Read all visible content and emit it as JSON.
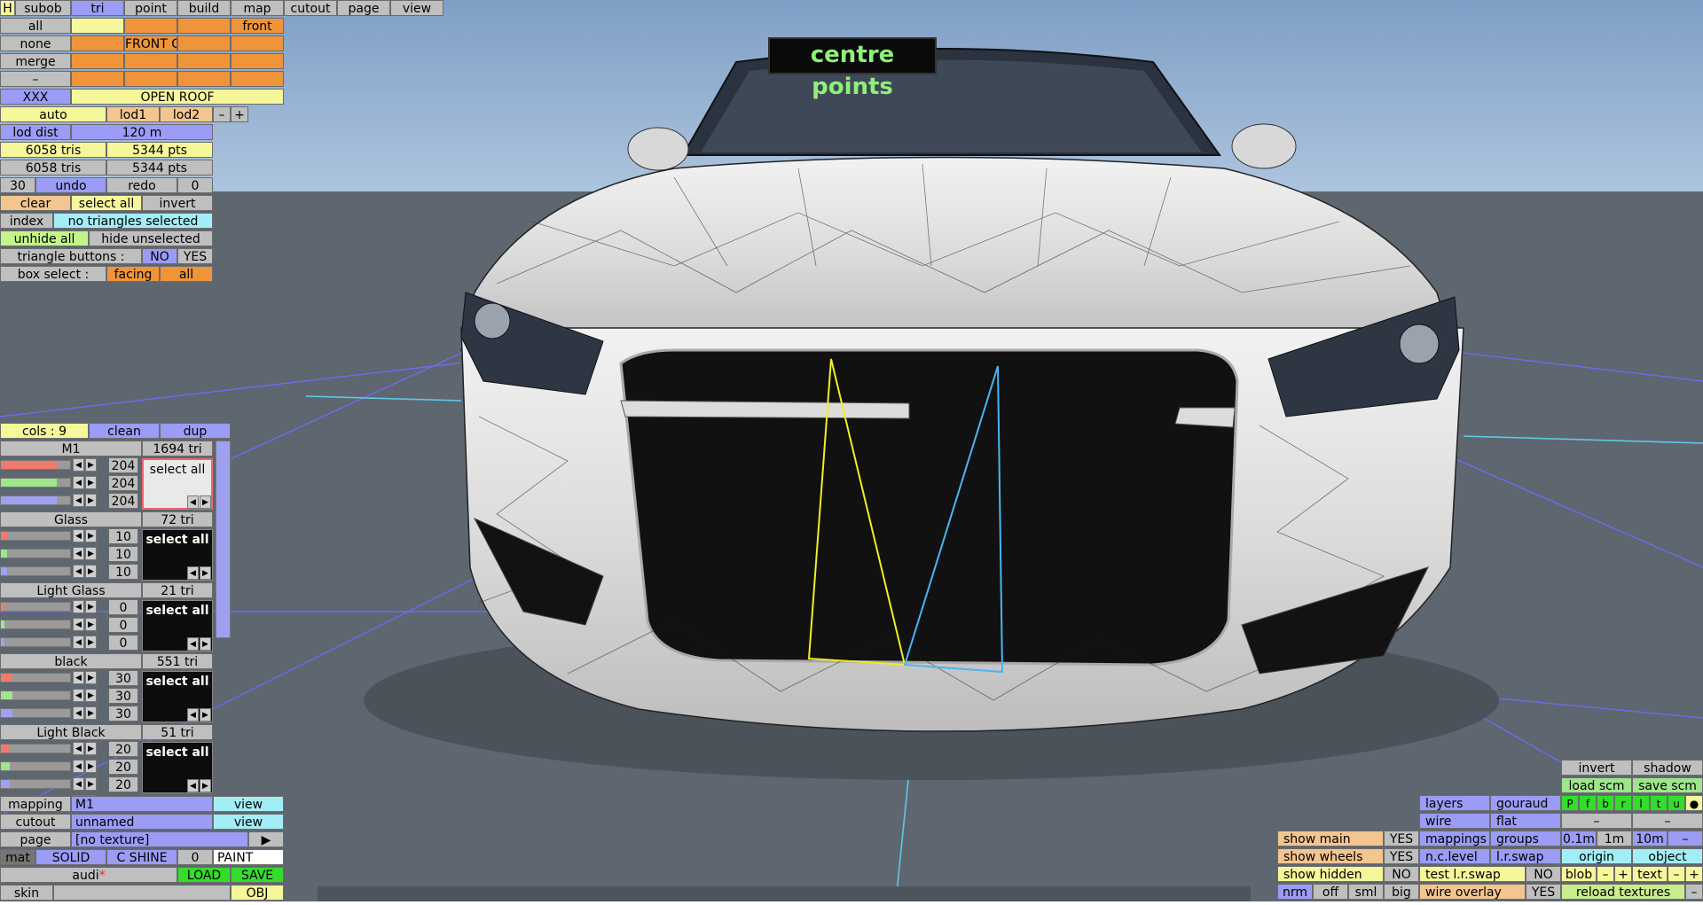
{
  "app": {
    "overlay_title": "centre points"
  },
  "menu": [
    "H",
    "subob",
    "tri",
    "point",
    "build",
    "map",
    "cutout",
    "page",
    "view"
  ],
  "groups_grid": {
    "row1": {
      "label": "all",
      "cells": [
        "",
        "",
        "",
        "front"
      ]
    },
    "row2": {
      "label": "none",
      "cells": [
        "FRONT G",
        "",
        "",
        ""
      ]
    },
    "row3": {
      "label": "merge",
      "cells": [
        "",
        "",
        "",
        ""
      ]
    },
    "row4": {
      "label": "–",
      "cells": [
        "",
        "",
        "",
        ""
      ]
    },
    "row5": {
      "label": "XXX",
      "wide": "OPEN ROOF"
    }
  },
  "lod": {
    "auto": "auto",
    "lod1": "lod1",
    "lod2": "lod2",
    "minus": "–",
    "plus": "+",
    "dist_label": "lod dist",
    "dist_value": "120 m"
  },
  "stats": {
    "tris1": "6058 tris",
    "pts1": "5344 pts",
    "tris2": "6058 tris",
    "pts2": "5344 pts"
  },
  "history": {
    "undo_count": "30",
    "undo": "undo",
    "redo": "redo",
    "redo_count": "0"
  },
  "selection": {
    "clear": "clear",
    "select_all": "select all",
    "invert": "invert",
    "index": "index",
    "index_status": "no triangles selected",
    "unhide_all": "unhide all",
    "hide_unselected": "hide unselected",
    "tri_buttons_label": "triangle buttons :",
    "no": "NO",
    "yes": "YES",
    "box_select_label": "box select :",
    "facing": "facing",
    "all": "all"
  },
  "colours": {
    "header": {
      "cols": "cols : 9",
      "clean": "clean",
      "dup": "dup"
    },
    "materials": [
      {
        "name": "M1",
        "tri": "1694 tri",
        "r": "204",
        "g": "204",
        "b": "204",
        "fill": 0.8,
        "btn": "select all"
      },
      {
        "name": "Glass",
        "tri": "72 tri",
        "r": "10",
        "g": "10",
        "b": "10",
        "fill": 0.04,
        "btn": "select all"
      },
      {
        "name": "Light Glass",
        "tri": "21 tri",
        "r": "0",
        "g": "0",
        "b": "0",
        "fill": 0.0,
        "btn": "select all"
      },
      {
        "name": "black",
        "tri": "551 tri",
        "r": "30",
        "g": "30",
        "b": "30",
        "fill": 0.12,
        "btn": "select all"
      },
      {
        "name": "Light Black",
        "tri": "51 tri",
        "r": "20",
        "g": "20",
        "b": "20",
        "fill": 0.08,
        "btn": "select all"
      }
    ]
  },
  "bottom_left": {
    "mapping_label": "mapping",
    "mapping_value": "M1",
    "view1": "view",
    "cutout_label": "cutout",
    "cutout_value": "unnamed",
    "view2": "view",
    "page_label": "page",
    "page_value": "[no texture]",
    "play": "▶",
    "mat": "mat",
    "solid": "SOLID",
    "cshine": "C SHINE",
    "zero": "0",
    "paint": "PAINT",
    "file": "audi",
    "star": "*",
    "load": "LOAD",
    "save": "SAVE",
    "skin": "skin",
    "obj": "OBJ"
  },
  "bottom_right": {
    "invert": "invert",
    "shadow": "shadow",
    "load_scm": "load scm",
    "save_scm": "save scm",
    "layers": "layers",
    "gouraud": "gouraud",
    "layer_buttons": [
      "P",
      "f",
      "b",
      "r",
      "l",
      "t",
      "u",
      "●"
    ],
    "wire": "wire",
    "flat": "flat",
    "dash1": "–",
    "dash2": "–",
    "show_main": "show main",
    "show_main_v": "YES",
    "mappings": "mappings",
    "groups": "groups",
    "g1": "0.1m",
    "g2": "1m",
    "g3": "10m",
    "g4": "–",
    "show_wheels": "show wheels",
    "show_wheels_v": "YES",
    "nclevel": "n.c.level",
    "lrswap": "l.r.swap",
    "origin": "origin",
    "object": "object",
    "show_hidden": "show hidden",
    "show_hidden_v": "NO",
    "test_lrswap": "test l.r.swap",
    "test_lrswap_v": "NO",
    "blob": "blob",
    "bm": "–",
    "bp": "+",
    "text": "text",
    "tm": "–",
    "tp": "+",
    "nrm": "nrm",
    "off": "off",
    "sml": "sml",
    "big": "big",
    "wire_overlay": "wire overlay",
    "wire_overlay_v": "YES",
    "reload": "reload textures",
    "rm": "–"
  },
  "colors": {
    "sky_top": "#7f9fc6",
    "sky_bottom": "#a9c1dc",
    "ground": "#5e6670"
  }
}
